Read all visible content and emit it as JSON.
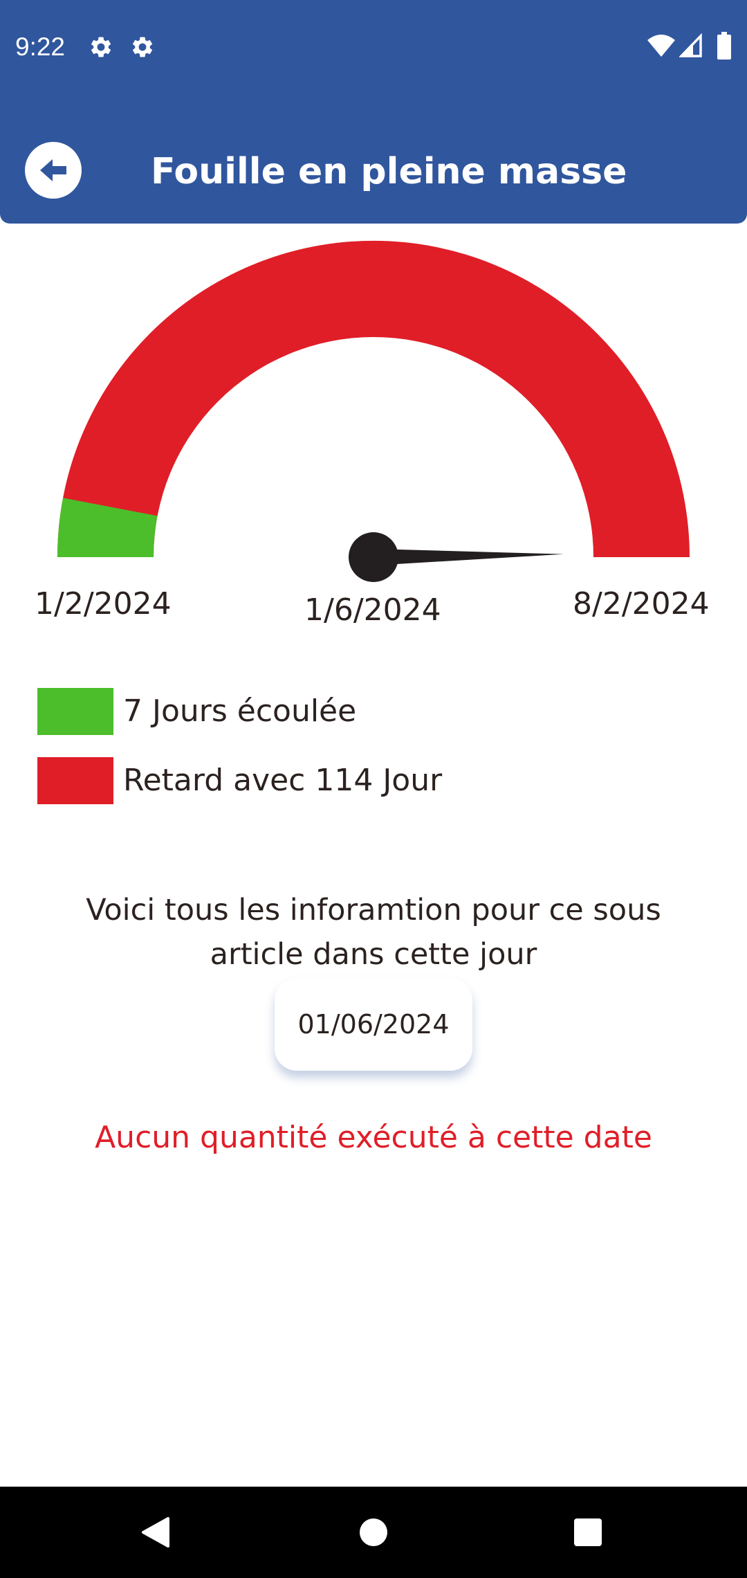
{
  "status_bar": {
    "time": "9:22",
    "icons": [
      "settings-gear-icon",
      "settings-outline-icon",
      "wifi-icon",
      "signal-icon",
      "battery-icon"
    ]
  },
  "header": {
    "title": "Fouille en pleine masse",
    "back_icon": "arrow-left-circle-icon"
  },
  "gauge": {
    "start_label": "1/2/2024",
    "end_label": "8/2/2024",
    "pointer_label": "1/6/2024",
    "elapsed_fraction": 0.06,
    "needle_fraction": 0.995,
    "colors": {
      "elapsed": "#4cbd2b",
      "delay": "#e01e28",
      "needle": "#231f20"
    }
  },
  "legend": [
    {
      "color": "#4cbd2b",
      "label": "7 Jours écoulée"
    },
    {
      "color": "#e01e28",
      "label": "Retard avec 114 Jour"
    }
  ],
  "info": {
    "text": "Voici tous les inforamtion pour ce sous article dans cette jour",
    "selected_date": "01/06/2024",
    "message": "Aucun quantité exécuté à cette date",
    "message_color": "#e01e28"
  },
  "nav_bar": {
    "icons": [
      "back-triangle-icon",
      "home-circle-icon",
      "recents-square-icon"
    ]
  },
  "theme": {
    "primary": "#30569e",
    "text": "#2b2220"
  }
}
